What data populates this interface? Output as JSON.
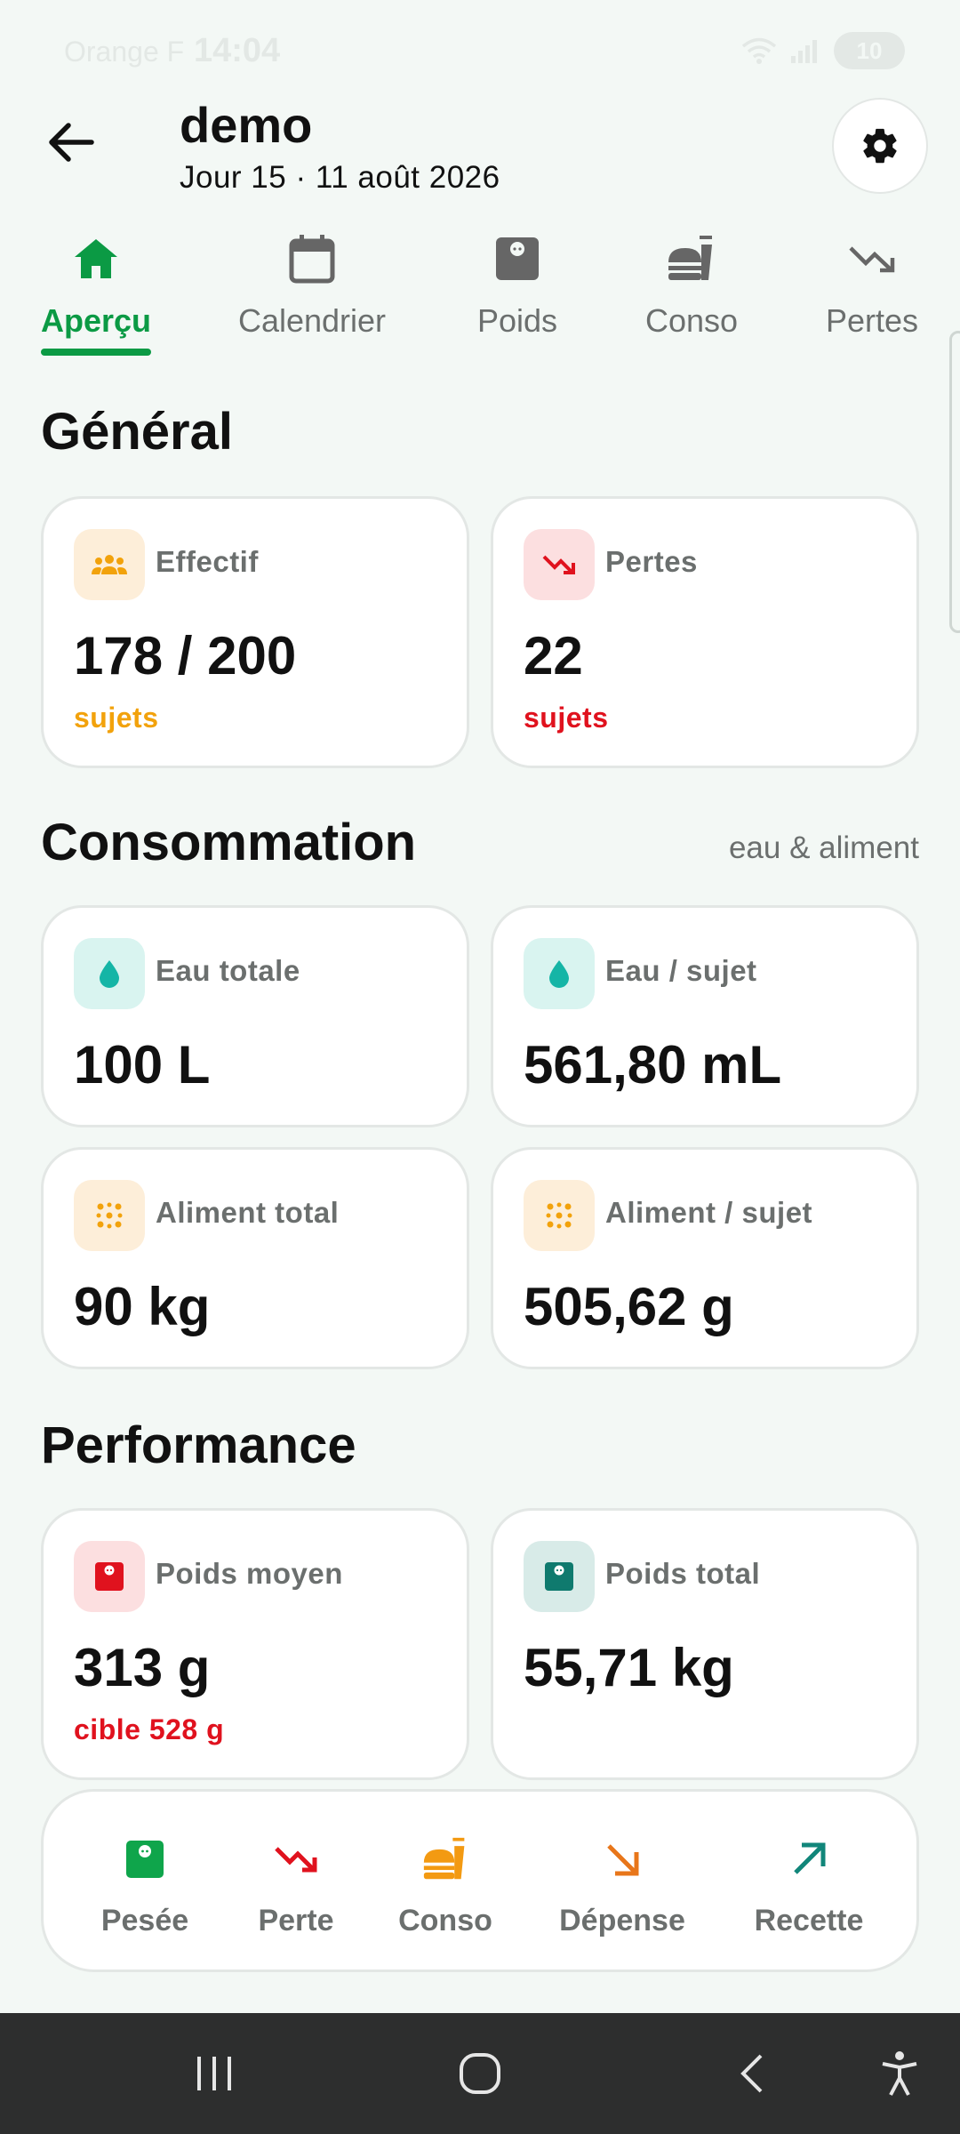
{
  "status_bar": {
    "carrier": "Orange F",
    "time": "14:04",
    "battery": "10"
  },
  "header": {
    "title": "demo",
    "subtitle": "Jour 15 · 11 août 2026"
  },
  "tabs": [
    {
      "label": "Aperçu",
      "icon": "home-icon",
      "active": true
    },
    {
      "label": "Calendrier",
      "icon": "calendar-icon"
    },
    {
      "label": "Poids",
      "icon": "scale-icon"
    },
    {
      "label": "Conso",
      "icon": "food-icon"
    },
    {
      "label": "Pertes",
      "icon": "trending-down-icon"
    }
  ],
  "general": {
    "title": "Général",
    "effectif": {
      "label": "Effectif",
      "value": "178 / 200",
      "sub": "sujets"
    },
    "pertes": {
      "label": "Pertes",
      "value": "22",
      "sub": "sujets"
    }
  },
  "consommation": {
    "title": "Consommation",
    "aside": "eau & aliment",
    "eau_totale": {
      "label": "Eau totale",
      "value": "100 L"
    },
    "eau_sujet": {
      "label": "Eau / sujet",
      "value": "561,80 mL"
    },
    "aliment_total": {
      "label": "Aliment total",
      "value": "90 kg"
    },
    "aliment_sujet": {
      "label": "Aliment / sujet",
      "value": "505,62 g"
    }
  },
  "performance": {
    "title": "Performance",
    "poids_moyen": {
      "label": "Poids moyen",
      "value": "313 g",
      "sub": "cible 528 g"
    },
    "poids_total": {
      "label": "Poids total",
      "value": "55,71 kg"
    }
  },
  "quick_actions": [
    {
      "label": "Pesée",
      "icon": "scale-icon",
      "color": "#0fa54b"
    },
    {
      "label": "Perte",
      "icon": "trending-down-icon",
      "color": "#e0121e"
    },
    {
      "label": "Conso",
      "icon": "food-icon",
      "color": "#f39a12"
    },
    {
      "label": "Dépense",
      "icon": "arrow-down-right-icon",
      "color": "#e8761a"
    },
    {
      "label": "Recette",
      "icon": "arrow-up-right-icon",
      "color": "#11867a"
    }
  ],
  "colors": {
    "accent_green": "#0b9a44",
    "orange": "#f2a20c",
    "red": "#e0121e",
    "teal": "#15b5a6",
    "dark_teal": "#0f7a6e"
  }
}
